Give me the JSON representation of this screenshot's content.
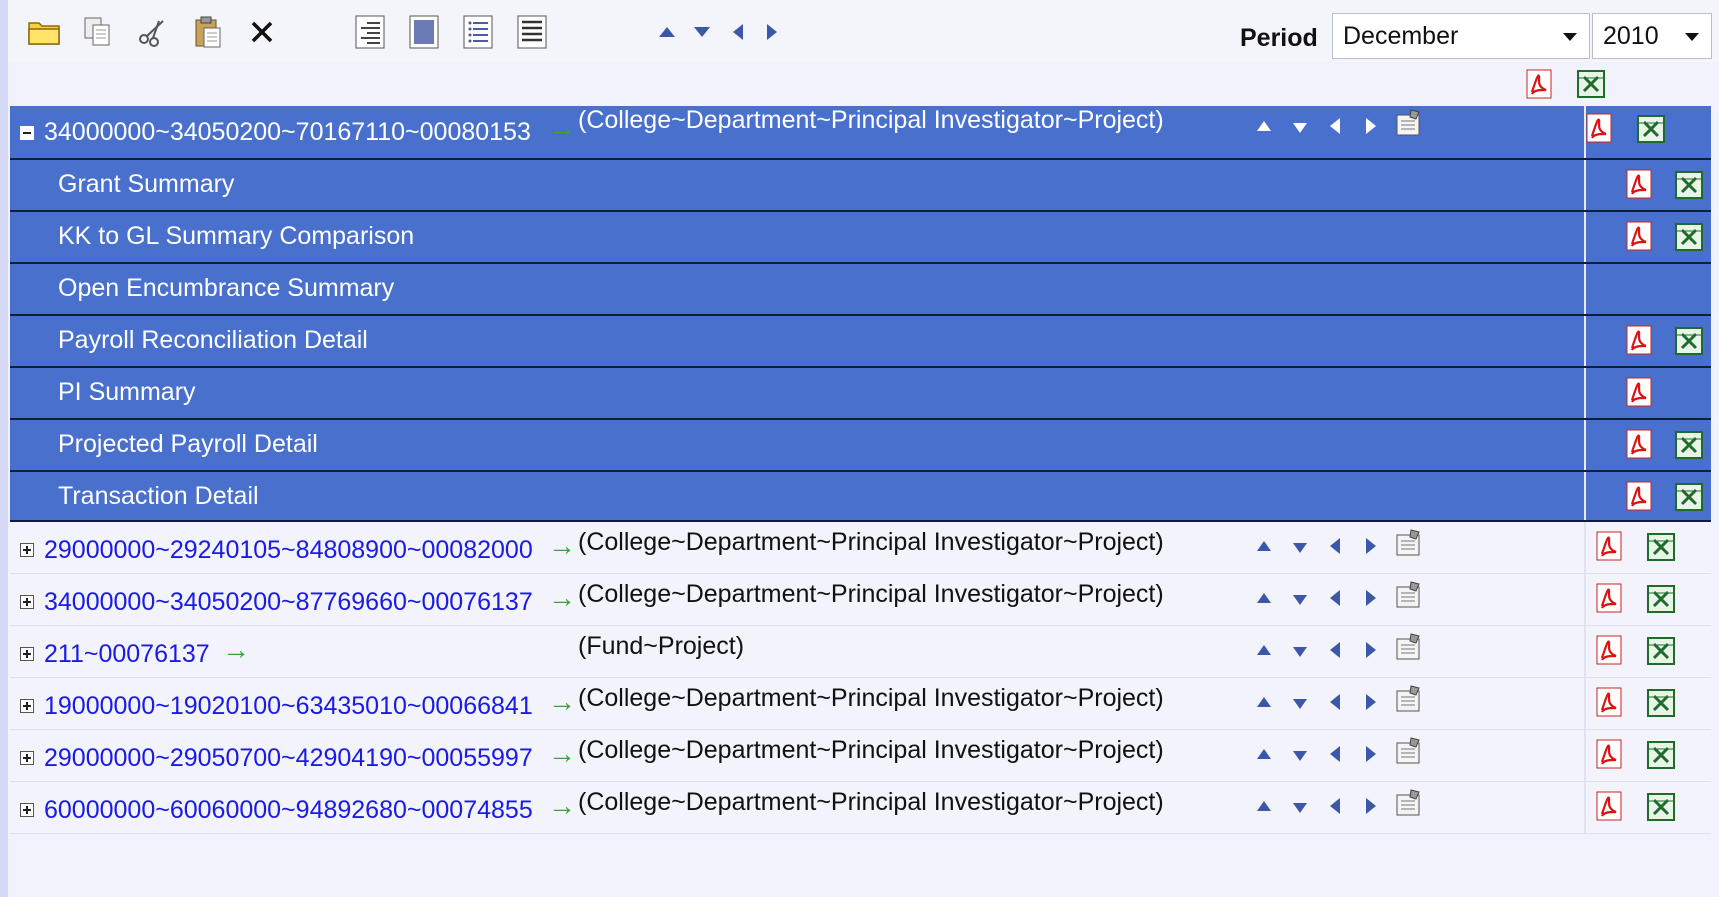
{
  "toolbar": {
    "icons": [
      "folder-icon",
      "copy-icon",
      "cut-icon",
      "paste-icon",
      "delete-icon",
      "align-right-icon",
      "justify-icon",
      "list-icon",
      "align-left-icon"
    ],
    "nav": [
      "up",
      "down",
      "left",
      "right"
    ],
    "period_label": "Period",
    "period_month": "December",
    "period_year": "2010"
  },
  "selected_row": {
    "code": "34000000~34050200~70167110~00080153",
    "desc": "(College~Department~Principal Investigator~Project)",
    "reports": [
      {
        "label": "Grant Summary",
        "pdf": true,
        "xls": true
      },
      {
        "label": "KK to GL Summary Comparison",
        "pdf": true,
        "xls": true
      },
      {
        "label": "Open Encumbrance Summary",
        "pdf": false,
        "xls": false
      },
      {
        "label": "Payroll Reconciliation Detail",
        "pdf": true,
        "xls": true
      },
      {
        "label": "PI Summary",
        "pdf": true,
        "xls": false
      },
      {
        "label": "Projected Payroll Detail",
        "pdf": true,
        "xls": true
      },
      {
        "label": "Transaction Detail",
        "pdf": true,
        "xls": true
      }
    ]
  },
  "rows": [
    {
      "code": "29000000~29240105~84808900~00082000",
      "desc": "(College~Department~Principal Investigator~Project)"
    },
    {
      "code": "34000000~34050200~87769660~00076137",
      "desc": "(College~Department~Principal Investigator~Project)"
    },
    {
      "code": "211~00076137",
      "desc": "(Fund~Project)"
    },
    {
      "code": "19000000~19020100~63435010~00066841",
      "desc": "(College~Department~Principal Investigator~Project)"
    },
    {
      "code": "29000000~29050700~42904190~00055997",
      "desc": "(College~Department~Principal Investigator~Project)"
    },
    {
      "code": "60000000~60060000~94892680~00074855",
      "desc": "(College~Department~Principal Investigator~Project)"
    }
  ],
  "colors": {
    "selected_bg": "#4870cc",
    "link": "#1a1ae6",
    "arrow_green": "#3aa33a"
  }
}
